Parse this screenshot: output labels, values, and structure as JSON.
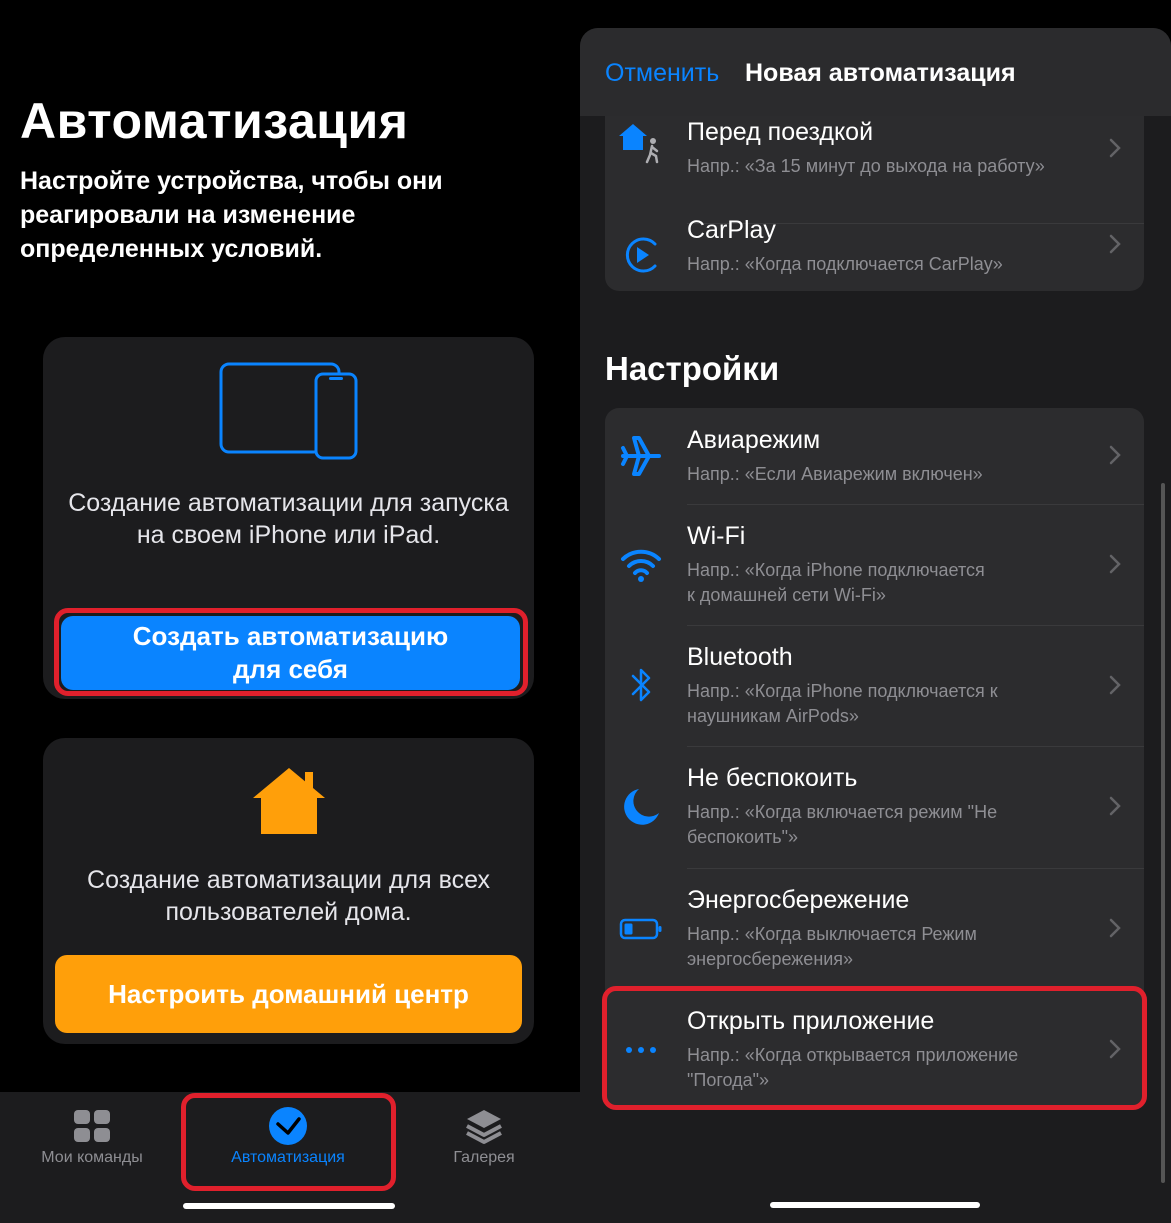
{
  "left": {
    "title": "Автоматизация",
    "subtitle": "Настройте устройства, чтобы они реагировали на изменение определенных условий.",
    "personal_card": {
      "description": "Создание автоматизации для запуска на своем iPhone или iPad.",
      "button_line1": "Создать автоматизацию",
      "button_line2": "для себя"
    },
    "home_card": {
      "description": "Создание автоматизации для всех пользователей дома.",
      "button": "Настроить домашний центр"
    },
    "tabs": [
      {
        "label": "Мои команды",
        "icon": "grid-icon",
        "active": false
      },
      {
        "label": "Автоматизация",
        "icon": "clock-check-icon",
        "active": true
      },
      {
        "label": "Галерея",
        "icon": "layers-icon",
        "active": false
      }
    ]
  },
  "right": {
    "nav": {
      "cancel": "Отменить",
      "title": "Новая автоматизация"
    },
    "top_rows": [
      {
        "title": "Перед поездкой",
        "sub": "Напр.: «За 15 минут до выхода на работу»",
        "icon": "home-walk-icon"
      },
      {
        "title": "CarPlay",
        "sub": "Напр.: «Когда подключается CarPlay»",
        "icon": "carplay-icon"
      }
    ],
    "section_title": "Настройки",
    "settings_rows": [
      {
        "title": "Авиарежим",
        "sub1": "Напр.: «Если Авиарежим включен»",
        "sub2": "",
        "icon": "airplane-icon"
      },
      {
        "title": "Wi-Fi",
        "sub1": "Напр.: «Когда iPhone подключается",
        "sub2": "к домашней сети Wi-Fi»",
        "icon": "wifi-icon"
      },
      {
        "title": "Bluetooth",
        "sub1": "Напр.: «Когда iPhone подключается к",
        "sub2": "наушникам AirPods»",
        "icon": "bluetooth-icon"
      },
      {
        "title": "Не беспокоить",
        "sub1": "Напр.: «Когда включается режим \"Не",
        "sub2": "беспокоить\"»",
        "icon": "moon-icon"
      },
      {
        "title": "Энергосбережение",
        "sub1": "Напр.: «Когда выключается Режим",
        "sub2": "энергосбережения»",
        "icon": "battery-icon"
      },
      {
        "title": "Открыть приложение",
        "sub1": "Напр.: «Когда открывается приложение",
        "sub2": "\"Погода\"»",
        "icon": "ellipsis-icon"
      }
    ]
  },
  "colors": {
    "accent_blue": "#0a84ff",
    "accent_orange": "#ff9f0a",
    "highlight_red": "#e0202c",
    "card_bg": "#1c1c1e",
    "row_bg": "#2c2c2e"
  }
}
